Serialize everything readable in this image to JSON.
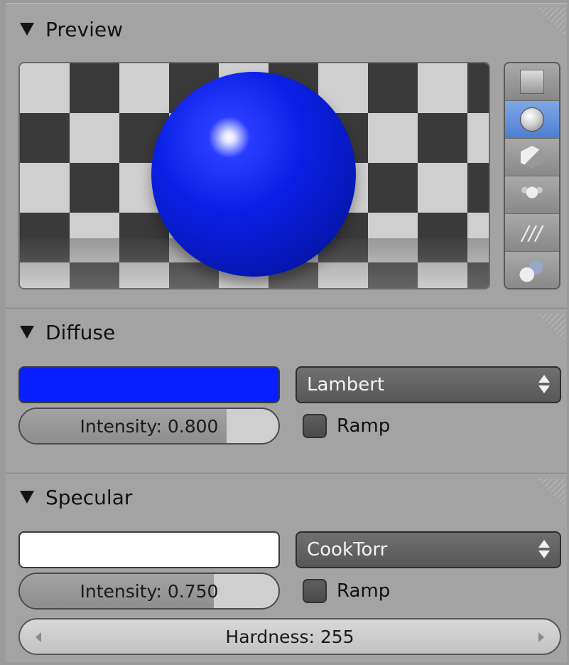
{
  "preview": {
    "title": "Preview",
    "material_color": "#0a1fe6",
    "preview_types": [
      {
        "icon": "flat-plane-icon",
        "active": false
      },
      {
        "icon": "sphere-icon",
        "active": true
      },
      {
        "icon": "cube-icon",
        "active": false
      },
      {
        "icon": "monkey-icon",
        "active": false
      },
      {
        "icon": "hair-strands-icon",
        "active": false
      },
      {
        "icon": "world-sphere-icon",
        "active": false
      }
    ]
  },
  "diffuse": {
    "title": "Diffuse",
    "color": "#0a1fff",
    "shader": "Lambert",
    "intensity_label": "Intensity: 0.800",
    "intensity_value": 0.8,
    "ramp_label": "Ramp",
    "ramp_checked": false
  },
  "specular": {
    "title": "Specular",
    "color": "#ffffff",
    "shader": "CookTorr",
    "intensity_label": "Intensity: 0.750",
    "intensity_value": 0.75,
    "ramp_label": "Ramp",
    "ramp_checked": false,
    "hardness_label": "Hardness: 255"
  }
}
